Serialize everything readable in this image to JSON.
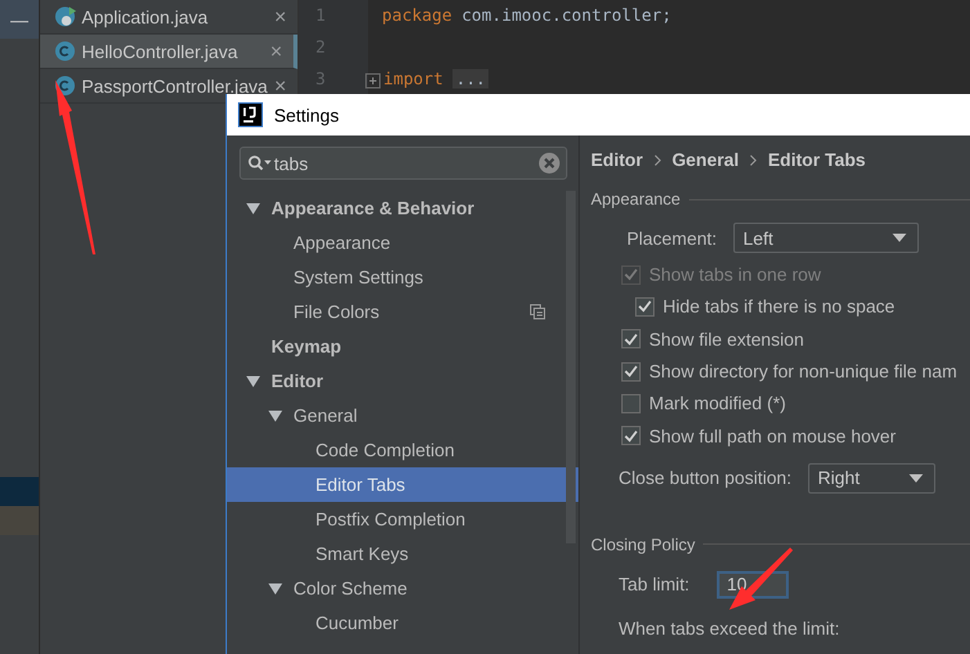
{
  "sidebar": {
    "collapse_button": "—",
    "highlights": [
      {
        "color": "#0d293e"
      },
      {
        "color": "#48453e"
      }
    ]
  },
  "file_tabs": [
    {
      "name": "Application.java",
      "kind": "app",
      "selected": false,
      "close": "×"
    },
    {
      "name": "HelloController.java",
      "kind": "class",
      "selected": true,
      "close": "×"
    },
    {
      "name": "PassportController.java",
      "kind": "class",
      "selected": false,
      "close": "×"
    }
  ],
  "code_lines": [
    {
      "number": "1",
      "keyword": "package",
      "text": "com.imooc.controller;"
    },
    {
      "number": "2"
    },
    {
      "number": "3",
      "keyword": "import",
      "text": "...",
      "folded": true
    }
  ],
  "settings": {
    "title": "Settings",
    "search": {
      "value": "tabs"
    },
    "tree": [
      {
        "label": "Appearance & Behavior",
        "expanded": true,
        "selected": false,
        "badge": false,
        "children": [
          {
            "label": "Appearance",
            "selected": false,
            "badge": false
          },
          {
            "label": "System Settings",
            "selected": false,
            "badge": false
          },
          {
            "label": "File Colors",
            "selected": false,
            "badge": true
          }
        ]
      },
      {
        "label": "Keymap",
        "selected": false,
        "badge": false
      },
      {
        "label": "Editor",
        "expanded": true,
        "selected": false,
        "badge": false,
        "children": [
          {
            "label": "General",
            "expanded": true,
            "selected": false,
            "badge": false,
            "children": [
              {
                "label": "Code Completion",
                "selected": false,
                "badge": false
              },
              {
                "label": "Editor Tabs",
                "selected": true,
                "badge": false
              },
              {
                "label": "Postfix Completion",
                "selected": false,
                "badge": false
              },
              {
                "label": "Smart Keys",
                "selected": false,
                "badge": false
              }
            ]
          },
          {
            "label": "Color Scheme",
            "expanded": true,
            "selected": false,
            "badge": false,
            "children": [
              {
                "label": "Cucumber",
                "selected": false,
                "badge": false
              }
            ]
          }
        ]
      }
    ],
    "breadcrumb": [
      "Editor",
      "General",
      "Editor Tabs"
    ],
    "appearance": {
      "heading": "Appearance",
      "placement": {
        "label": "Placement:",
        "value": "Left"
      },
      "options": [
        {
          "label": "Show tabs in one row",
          "checked": true,
          "disabled": true,
          "children": [
            {
              "label": "Hide tabs if there is no space",
              "checked": true,
              "disabled": false
            }
          ]
        },
        {
          "label": "Show file extension",
          "checked": true,
          "disabled": false
        },
        {
          "label": "Show directory for non-unique file nam",
          "checked": true,
          "disabled": false
        },
        {
          "label": "Mark modified (*)",
          "checked": false,
          "disabled": false
        },
        {
          "label": "Show full path on mouse hover",
          "checked": true,
          "disabled": false
        }
      ],
      "close_button_position": {
        "label": "Close button position:",
        "value": "Right"
      }
    },
    "closing_policy": {
      "heading": "Closing Policy",
      "tab_limit": {
        "label": "Tab limit:",
        "value": "10"
      },
      "exceed_label": "When tabs exceed the limit:"
    }
  }
}
